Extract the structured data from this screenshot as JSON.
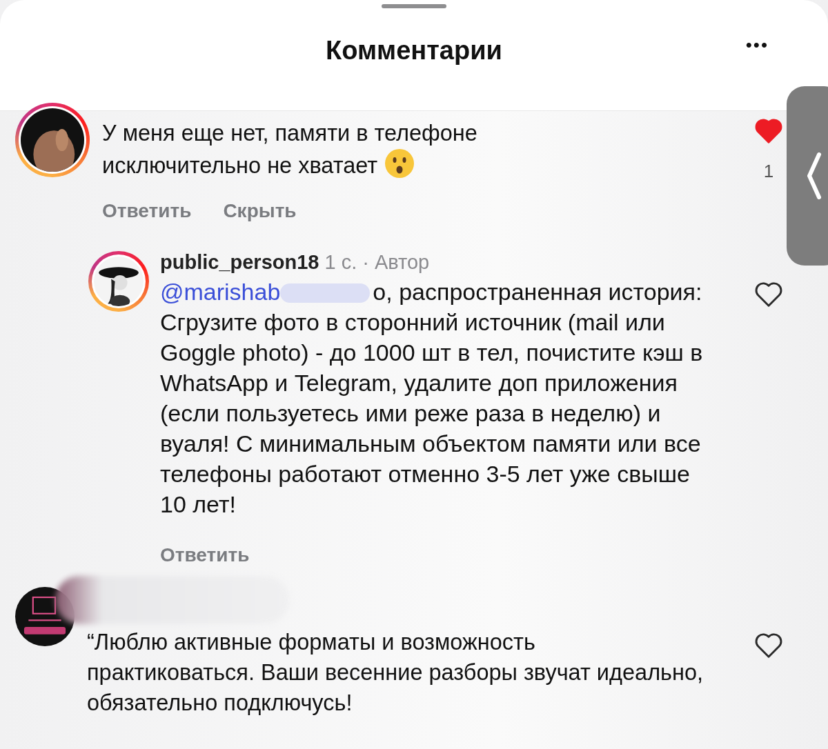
{
  "header": {
    "title": "Комментарии",
    "menu": "•••"
  },
  "comments": [
    {
      "kind": "top",
      "text": "У меня еще нет, памяти в телефоне исключительно не хватает",
      "emoji": true,
      "actions": [
        "Ответить",
        "Скрыть"
      ],
      "liked": true,
      "likes": "1",
      "avatar_ring": true
    },
    {
      "kind": "reply",
      "author": "public_person18",
      "time": "1 с.",
      "separator": "·",
      "badge": "Автор",
      "mention": "@marishab",
      "redacted": true,
      "text": "о, распространенная история: Сгрузите фото в сторонний источник (mail или Goggle photo) - до 1000 шт в тел, почистите кэш в WhatsApp и Telegram, удалите доп приложения (если пользуетесь ими реже раза в неделю) и вуаля! С минимальным объектом памяти или все телефоны работают отменно 3-5 лет уже свыше 10 лет!",
      "actions": [
        "Ответить"
      ],
      "liked": false,
      "avatar_ring": true
    },
    {
      "kind": "top",
      "redacted": true,
      "text": "“Люблю активные форматы и возможность практиковаться. Ваши весенние разборы звучат идеально, обязательно подключусь!",
      "emoji": false,
      "liked": false,
      "avatar_ring": false
    }
  ]
}
